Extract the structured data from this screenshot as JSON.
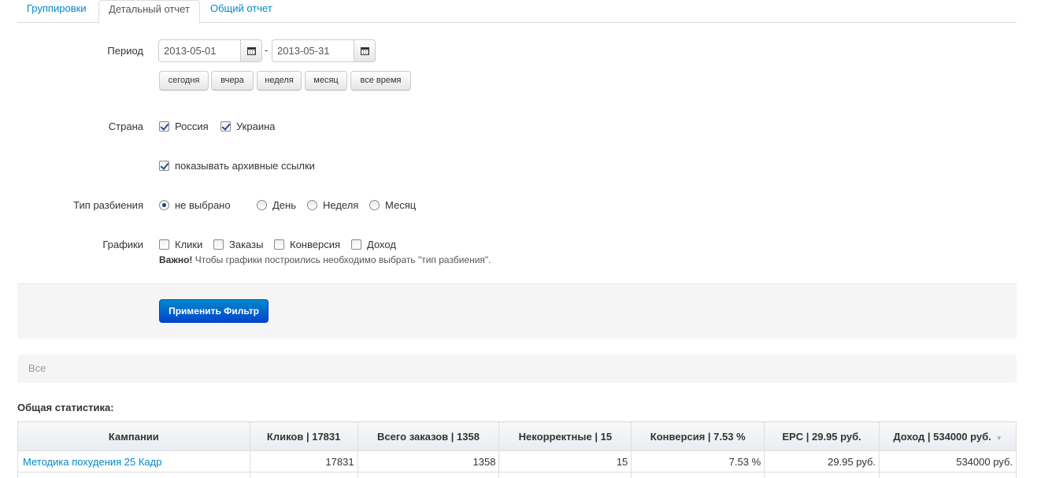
{
  "tabs": [
    {
      "label": "Группировки",
      "active": false
    },
    {
      "label": "Детальный отчет",
      "active": true
    },
    {
      "label": "Общий отчет",
      "active": false
    }
  ],
  "filter": {
    "period": {
      "label": "Период",
      "from": "2013-05-01",
      "to": "2013-05-31",
      "separator": "-",
      "quick": [
        "сегодня",
        "вчера",
        "неделя",
        "месяц",
        "все время"
      ]
    },
    "country": {
      "label": "Страна",
      "options": [
        {
          "label": "Россия",
          "checked": true
        },
        {
          "label": "Украина",
          "checked": true
        }
      ]
    },
    "archive": {
      "label": "показывать архивные ссылки",
      "checked": true
    },
    "split": {
      "label": "Тип разбиения",
      "options": [
        {
          "label": "не выбрано",
          "checked": true
        },
        {
          "label": "День",
          "checked": false
        },
        {
          "label": "Неделя",
          "checked": false
        },
        {
          "label": "Месяц",
          "checked": false
        }
      ]
    },
    "charts": {
      "label": "Графики",
      "options": [
        {
          "label": "Клики",
          "checked": false
        },
        {
          "label": "Заказы",
          "checked": false
        },
        {
          "label": "Конверсия",
          "checked": false
        },
        {
          "label": "Доход",
          "checked": false
        }
      ],
      "note_bold": "Важно!",
      "note_text": " Чтобы графики построились необходимо выбрать \"тип разбиения\"."
    },
    "apply_label": "Применить Фильтр"
  },
  "breadcrumb": "Все",
  "stats": {
    "title": "Общая статистика:",
    "columns": [
      "Кампании",
      "Кликов | 17831",
      "Всего заказов | 1358",
      "Некорректные | 15",
      "Конверсия | 7.53 %",
      "EPC | 29.95 руб.",
      "Доход | 534000 руб."
    ],
    "rows": [
      [
        "Методика похудения 25 Кадр",
        "17831",
        "1358",
        "15",
        "7.53 %",
        "29.95 руб.",
        "534000 руб."
      ]
    ]
  },
  "colors": {
    "link": "#0088cc",
    "primary_button": "#0055cc"
  }
}
